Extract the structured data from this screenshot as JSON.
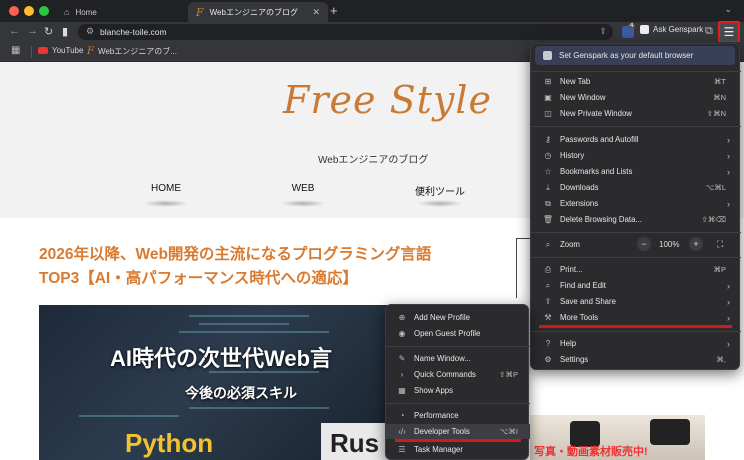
{
  "tabs": [
    {
      "label": "Home",
      "icon": "home-icon"
    },
    {
      "label": "Webエンジニアのブログ",
      "icon": "favicon-f"
    }
  ],
  "toolbar": {
    "url": "blanche-toile.com",
    "ext_count": "4",
    "ask_genspark": "Ask Genspark"
  },
  "bookmarks": [
    {
      "label": "YouTube"
    },
    {
      "label": "Webエンジニアのブ..."
    }
  ],
  "page": {
    "logo": "Free Style",
    "tagline": "Webエンジニアのブログ",
    "nav": [
      "HOME",
      "WEB",
      "便利ツール"
    ],
    "article_title_line1": "2026年以降、Web開発の主流になるプログラミング言語",
    "article_title_line2": "TOP3【AI・高パフォーマンス時代への適応】",
    "hero_title": "AI時代の次世代Web言",
    "hero_sub": "今後の必須スキル",
    "hero_python": "Python",
    "hero_rust": "Rus",
    "side_photo_text": "写真・動画素材販売中!"
  },
  "menu": {
    "promo": "Set Genspark as your default browser",
    "items": [
      {
        "label": "New Tab",
        "shortcut": "⌘T",
        "icon": "new-tab-icon"
      },
      {
        "label": "New Window",
        "shortcut": "⌘N",
        "icon": "new-window-icon"
      },
      {
        "label": "New Private Window",
        "shortcut": "⇧⌘N",
        "icon": "private-window-icon"
      },
      {
        "label": "Passwords and Autofill",
        "shortcut": "",
        "icon": "key-icon",
        "submenu": true
      },
      {
        "label": "History",
        "shortcut": "",
        "icon": "history-icon",
        "submenu": true
      },
      {
        "label": "Bookmarks and Lists",
        "shortcut": "",
        "icon": "bookmark-icon",
        "submenu": true
      },
      {
        "label": "Downloads",
        "shortcut": "⌥⌘L",
        "icon": "download-icon"
      },
      {
        "label": "Extensions",
        "shortcut": "",
        "icon": "puzzle-icon",
        "submenu": true
      },
      {
        "label": "Delete Browsing Data...",
        "shortcut": "⇧⌘⌫",
        "icon": "trash-icon"
      },
      {
        "label": "Zoom",
        "value": "100%",
        "icon": "zoom-icon"
      },
      {
        "label": "Print...",
        "shortcut": "⌘P",
        "icon": "print-icon"
      },
      {
        "label": "Find and Edit",
        "shortcut": "",
        "icon": "find-icon",
        "submenu": true
      },
      {
        "label": "Save and Share",
        "shortcut": "",
        "icon": "share-icon",
        "submenu": true
      },
      {
        "label": "More Tools",
        "shortcut": "",
        "icon": "tools-icon",
        "submenu": true
      },
      {
        "label": "Help",
        "shortcut": "",
        "icon": "help-icon",
        "submenu": true
      },
      {
        "label": "Settings",
        "shortcut": "⌘,",
        "icon": "settings-icon"
      }
    ]
  },
  "submenu": {
    "items": [
      {
        "label": "Add New Profile",
        "shortcut": "",
        "icon": "add-profile-icon"
      },
      {
        "label": "Open Guest Profile",
        "shortcut": "",
        "icon": "guest-profile-icon"
      },
      {
        "label": "Name Window...",
        "shortcut": "",
        "icon": "name-window-icon"
      },
      {
        "label": "Quick Commands",
        "shortcut": "⇧⌘P",
        "icon": "quick-commands-icon",
        "submenu": true
      },
      {
        "label": "Show Apps",
        "shortcut": "",
        "icon": "apps-icon"
      },
      {
        "label": "Performance",
        "shortcut": "",
        "icon": "performance-icon"
      },
      {
        "label": "Developer Tools",
        "shortcut": "⌥⌘I",
        "icon": "code-icon"
      },
      {
        "label": "Task Manager",
        "shortcut": "",
        "icon": "task-manager-icon"
      }
    ]
  },
  "colors": {
    "accent_orange": "#d97a2e",
    "highlight_red": "#d01a1a",
    "menu_bg": "#2b2b2e"
  }
}
